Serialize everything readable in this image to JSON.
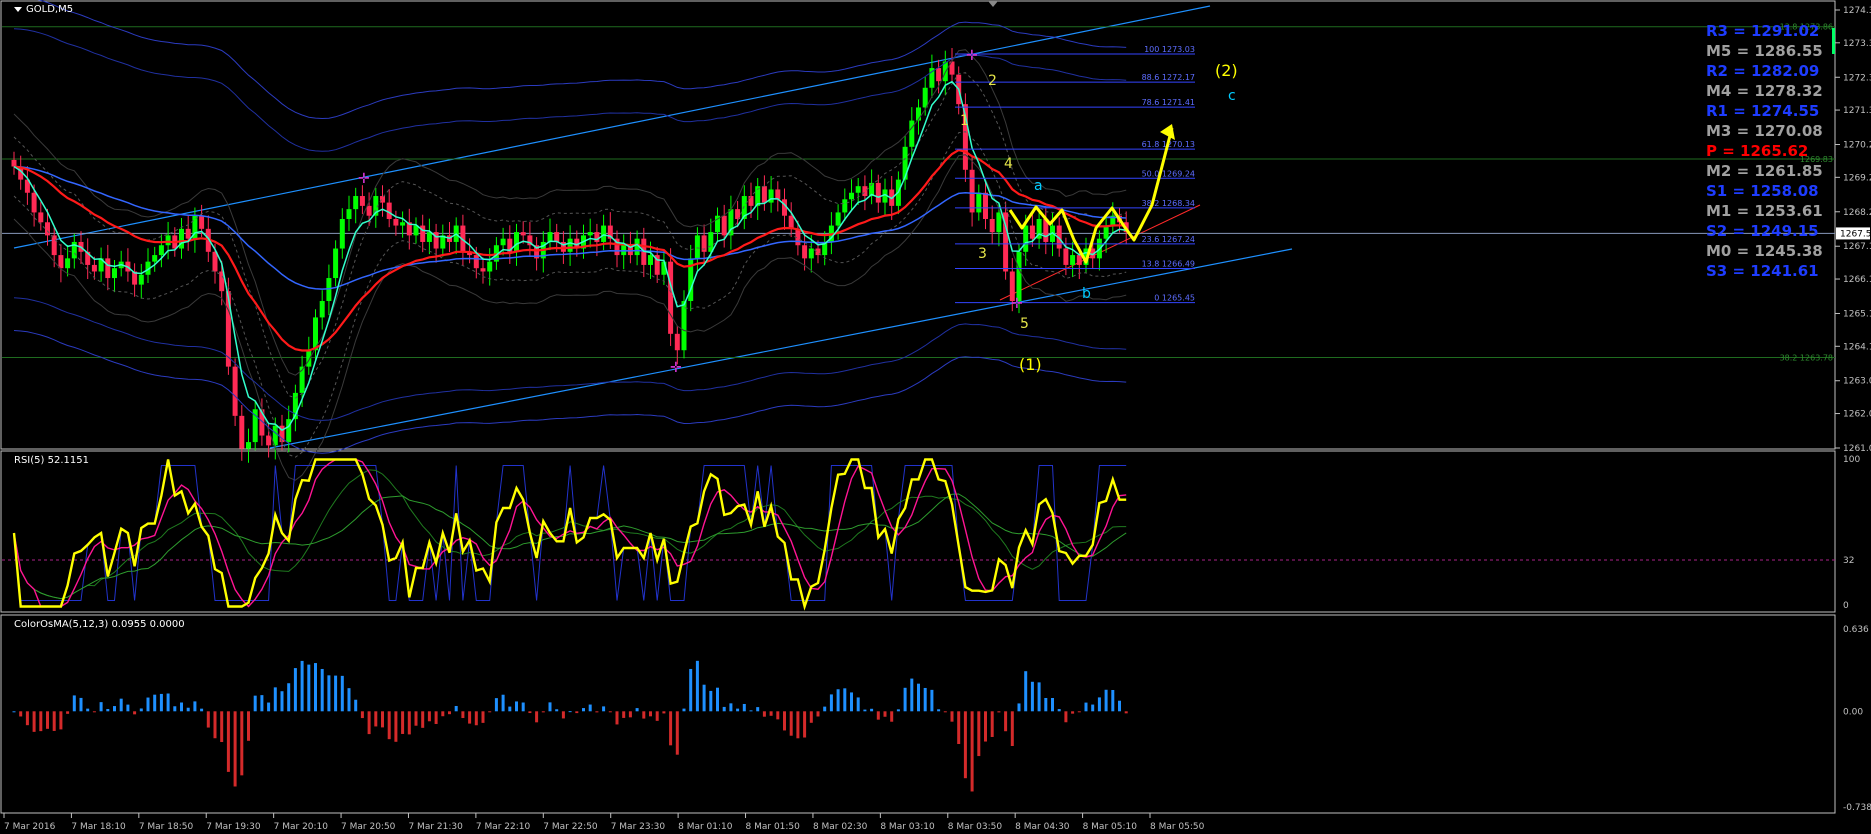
{
  "window": {
    "symbol_label": "GOLD,M5"
  },
  "colors": {
    "background": "#000000",
    "grid_frame": "#c0c0c0",
    "bull_candle": "#00ff00",
    "bear_candle": "#ff2a55",
    "ma_red": "#ff1a1a",
    "ma_green": "#33ffcc",
    "ma_blue": "#3366ff",
    "channel": "#1e90ff",
    "wave_yellow": "#ffff00",
    "wave_cyan": "#00ccff",
    "rsi_main": "#ffff00",
    "rsi_signal": "#ff1493",
    "osma_pos": "#1e90ff",
    "osma_neg": "#d42a2a",
    "pivot_blue": "#1e3cff",
    "pivot_gray": "#a0a0a0",
    "pivot_red": "#ff0000"
  },
  "price_panel": {
    "y_ticks": [
      "1274.37",
      "1273.37",
      "1272.32",
      "1271.32",
      "1270.27",
      "1269.27",
      "1268.22",
      "1267.17",
      "1266.17",
      "1265.12",
      "1264.12",
      "1263.07",
      "1262.07",
      "1261.02"
    ],
    "current_price": "1267.56",
    "fib_levels": [
      {
        "label": "100 1273.03",
        "price": 1273.03
      },
      {
        "label": "88.6 1272.17",
        "price": 1272.17
      },
      {
        "label": "78.6 1271.41",
        "price": 1271.41
      },
      {
        "label": "61.8 1270.13",
        "price": 1270.13
      },
      {
        "label": "50.0 1269.24",
        "price": 1269.24
      },
      {
        "label": "38.2 1268.34",
        "price": 1268.34
      },
      {
        "label": "23.6 1267.24",
        "price": 1267.24
      },
      {
        "label": "13.8 1266.49",
        "price": 1266.49
      },
      {
        "label": "0 1265.45",
        "price": 1265.45
      }
    ],
    "green_levels": [
      {
        "label": "13.8 1273.86",
        "price": 1273.86
      },
      {
        "label": "1269.83",
        "price": 1269.83
      },
      {
        "label": "38.2 1263.78",
        "price": 1263.78
      }
    ],
    "wave_labels": [
      "1",
      "2",
      "3",
      "4",
      "5",
      "a",
      "b",
      "c",
      "(1)",
      "(2)"
    ]
  },
  "pivots": [
    {
      "label": "R3 = 1291.02",
      "color": "blue"
    },
    {
      "label": "M5 = 1286.55",
      "color": "gray"
    },
    {
      "label": "R2 = 1282.09",
      "color": "blue"
    },
    {
      "label": "M4 = 1278.32",
      "color": "gray"
    },
    {
      "label": "R1 = 1274.55",
      "color": "blue"
    },
    {
      "label": "M3 = 1270.08",
      "color": "gray"
    },
    {
      "label": "P  = 1265.62",
      "color": "red"
    },
    {
      "label": "M2 = 1261.85",
      "color": "gray"
    },
    {
      "label": "S1 = 1258.08",
      "color": "blue"
    },
    {
      "label": "M1 = 1253.61",
      "color": "gray"
    },
    {
      "label": "S2 = 1249.15",
      "color": "blue"
    },
    {
      "label": "M0 = 1245.38",
      "color": "gray"
    },
    {
      "label": "S3 = 1241.61",
      "color": "blue"
    }
  ],
  "rsi_panel": {
    "title": "RSI(5) 52.1151",
    "y_ticks": [
      "100",
      "32",
      "0"
    ]
  },
  "osma_panel": {
    "title": "ColorOsMA(5,12,3) 0.0955 0.0000",
    "y_ticks": [
      "0.636",
      "0.00",
      "-0.7383"
    ]
  },
  "x_axis": {
    "labels": [
      "7 Mar 2016",
      "7 Mar 18:10",
      "7 Mar 18:50",
      "7 Mar 19:30",
      "7 Mar 20:10",
      "7 Mar 20:50",
      "7 Mar 21:30",
      "7 Mar 22:10",
      "7 Mar 22:50",
      "7 Mar 23:30",
      "8 Mar 01:10",
      "8 Mar 01:50",
      "8 Mar 02:30",
      "8 Mar 03:10",
      "8 Mar 03:50",
      "8 Mar 04:30",
      "8 Mar 05:10",
      "8 Mar 05:50"
    ]
  },
  "chart_data": {
    "type": "candlestick",
    "title": "GOLD,M5",
    "ylim": [
      1261.02,
      1274.37
    ],
    "closes": [
      1269.6,
      1269.2,
      1268.8,
      1268.2,
      1267.9,
      1267.5,
      1266.9,
      1266.5,
      1266.8,
      1267.3,
      1267.0,
      1266.6,
      1266.4,
      1266.8,
      1266.2,
      1266.5,
      1266.7,
      1266.4,
      1266.0,
      1266.3,
      1266.7,
      1266.9,
      1267.2,
      1267.5,
      1267.1,
      1267.7,
      1267.4,
      1268.1,
      1267.7,
      1267.0,
      1266.4,
      1265.8,
      1263.5,
      1262.0,
      1261.0,
      1261.2,
      1262.2,
      1261.4,
      1261.1,
      1261.7,
      1261.2,
      1261.9,
      1262.7,
      1263.5,
      1264.0,
      1265.0,
      1265.5,
      1266.2,
      1267.1,
      1268.0,
      1268.3,
      1268.7,
      1268.4,
      1268.1,
      1268.7,
      1268.5,
      1268.0,
      1267.8,
      1267.9,
      1267.5,
      1267.8,
      1267.3,
      1267.6,
      1267.1,
      1267.5,
      1267.3,
      1267.8,
      1267.0,
      1266.9,
      1266.5,
      1266.4,
      1266.7,
      1267.2,
      1267.4,
      1267.0,
      1267.6,
      1267.5,
      1267.2,
      1266.8,
      1267.3,
      1267.6,
      1267.3,
      1267.0,
      1267.4,
      1267.1,
      1267.5,
      1267.6,
      1267.3,
      1267.8,
      1267.4,
      1266.9,
      1267.2,
      1266.9,
      1267.4,
      1266.6,
      1266.9,
      1266.3,
      1266.7,
      1264.5,
      1264.0,
      1265.5,
      1266.8,
      1267.5,
      1267.0,
      1267.6,
      1268.1,
      1267.5,
      1268.3,
      1268.0,
      1268.7,
      1268.4,
      1269.0,
      1268.5,
      1268.9,
      1268.6,
      1268.1,
      1267.7,
      1267.2,
      1266.8,
      1267.1,
      1266.9,
      1267.3,
      1267.8,
      1268.2,
      1268.6,
      1268.8,
      1269.0,
      1268.7,
      1269.1,
      1268.5,
      1268.9,
      1268.4,
      1269.2,
      1270.2,
      1271.0,
      1271.4,
      1272.0,
      1272.6,
      1272.2,
      1272.8,
      1272.4,
      1271.5,
      1269.5,
      1268.2,
      1268.8,
      1268.0,
      1267.6,
      1268.2,
      1266.4,
      1265.5,
      1267.0,
      1267.8,
      1267.4,
      1268.0,
      1267.3,
      1267.8,
      1267.1,
      1266.6,
      1266.9,
      1266.6,
      1267.1,
      1266.8,
      1267.4,
      1267.8,
      1268.1,
      1267.9,
      1267.6
    ]
  }
}
